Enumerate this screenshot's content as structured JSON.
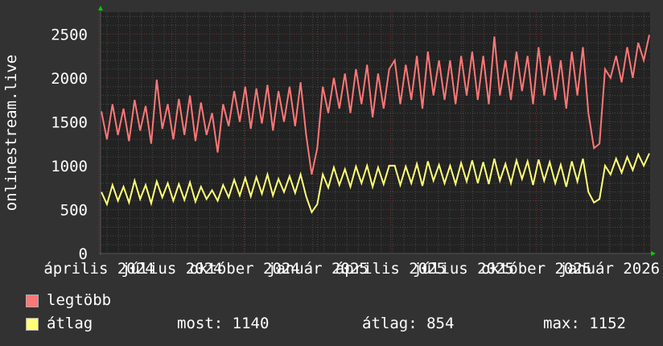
{
  "chart_data": {
    "type": "line",
    "ylabel": "onlinestream.live",
    "ylim": [
      0,
      2750
    ],
    "yticks": [
      0,
      500,
      1000,
      1500,
      2000,
      2500
    ],
    "xtick_labels": [
      "április 2024",
      "július 2024",
      "október 2024",
      "január 2025",
      "április 2025",
      "július 2025",
      "október 2025",
      "január 2026"
    ],
    "grid": true,
    "legend_placement": "bottom",
    "series": [
      {
        "name": "legtöbb",
        "color": "#ff7777",
        "values": [
          1620,
          1300,
          1700,
          1350,
          1650,
          1280,
          1750,
          1400,
          1680,
          1250,
          1980,
          1420,
          1700,
          1300,
          1760,
          1350,
          1800,
          1280,
          1720,
          1350,
          1600,
          1150,
          1700,
          1450,
          1850,
          1500,
          1900,
          1420,
          1880,
          1480,
          1920,
          1400,
          1850,
          1500,
          1900,
          1450,
          1950,
          1350,
          900,
          1200,
          1900,
          1600,
          2000,
          1650,
          2050,
          1600,
          2100,
          1700,
          2150,
          1550,
          2050,
          1650,
          2100,
          2200,
          1700,
          2150,
          1750,
          2250,
          1650,
          2300,
          1800,
          2200,
          1750,
          2200,
          1700,
          2250,
          1800,
          2300,
          1750,
          2250,
          1700,
          2470,
          1800,
          2200,
          1750,
          2300,
          1850,
          2250,
          1700,
          2350,
          1800,
          2250,
          1750,
          2200,
          1650,
          2300,
          1800,
          2350,
          1600,
          1200,
          1250,
          2100,
          2000,
          2250,
          1950,
          2350,
          2000,
          2400,
          2200,
          2490
        ]
      },
      {
        "name": "átlag",
        "color": "#ffff77",
        "values": [
          700,
          560,
          780,
          600,
          760,
          580,
          830,
          620,
          780,
          570,
          820,
          640,
          800,
          600,
          790,
          610,
          810,
          590,
          760,
          620,
          720,
          600,
          780,
          640,
          840,
          660,
          860,
          650,
          870,
          680,
          900,
          660,
          850,
          700,
          880,
          690,
          900,
          650,
          470,
          560,
          900,
          750,
          980,
          780,
          960,
          760,
          990,
          800,
          1000,
          760,
          980,
          790,
          1000,
          1000,
          780,
          990,
          800,
          1020,
          770,
          1050,
          830,
          1010,
          800,
          1000,
          790,
          1030,
          820,
          1060,
          800,
          1040,
          790,
          1080,
          830,
          1020,
          800,
          1060,
          850,
          1050,
          780,
          1070,
          830,
          1040,
          800,
          1010,
          760,
          1050,
          820,
          1080,
          700,
          580,
          620,
          1000,
          900,
          1080,
          920,
          1100,
          950,
          1130,
          1000,
          1140
        ]
      }
    ],
    "stats": {
      "most_label": "most: 1140",
      "atlag_label": "átlag: 854",
      "max_label": "max: 1152"
    }
  }
}
